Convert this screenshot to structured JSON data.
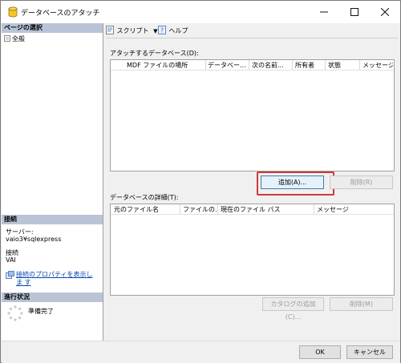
{
  "window": {
    "title": "データベースのアタッチ"
  },
  "left_pane": {
    "select_page_header": "ページの選択",
    "pages": [
      "全般"
    ],
    "connection_header": "接続",
    "server_label": "サーバー:",
    "server_value": "vaio3¥sqlexpress",
    "connection_label": "接続",
    "connection_value": "VAI",
    "view_properties_link": "接続のプロパティを表示しま す",
    "progress_header": "進行状況",
    "progress_status": "準備完了"
  },
  "toolbar": {
    "script_label": "スクリプト",
    "help_label": "ヘルプ"
  },
  "attach_section": {
    "label": "アタッチするデータベース(D):",
    "columns": [
      "MDF ファイルの場所",
      "データベー...",
      "次の名前...",
      "所有者",
      "状態",
      "メッセージ"
    ],
    "add_button": "追加(A)...",
    "remove_button": "削除(R)"
  },
  "details_section": {
    "label": "データベースの詳細(T):",
    "columns": [
      "元のファイル名",
      "ファイルの...",
      "現在のファイル パス",
      "メッセージ"
    ],
    "add_catalog_button": "カタログの追加(C)...",
    "remove_button": "削除(M)"
  },
  "footer": {
    "ok_button": "OK",
    "cancel_button": "キャンセル"
  }
}
